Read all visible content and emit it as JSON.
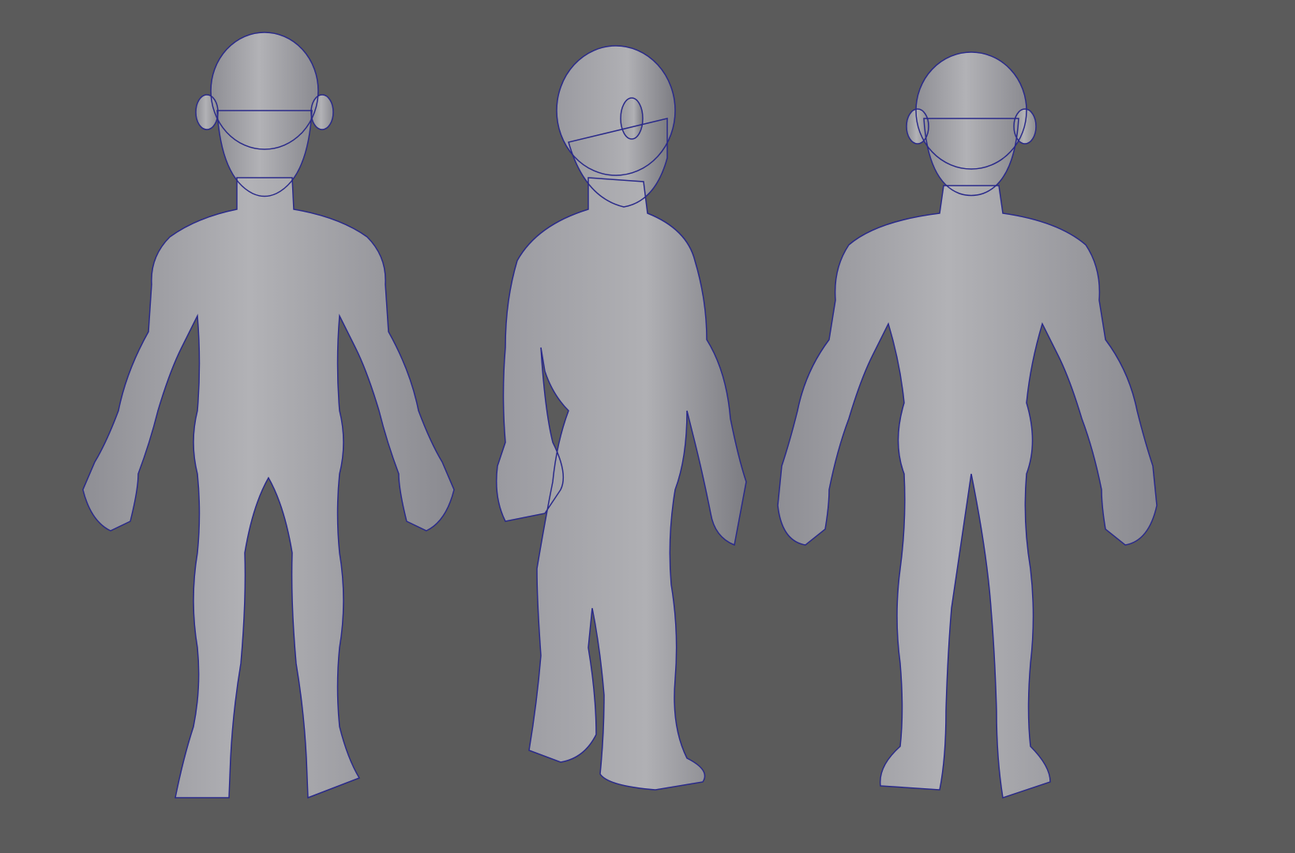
{
  "scene": {
    "background_color": "#5b5b5b",
    "mesh_color": "#a9a9ad",
    "mesh_shadow_color": "#7e7e84",
    "wire_color": "#2a2a8a",
    "views": [
      "front",
      "three-quarter-back",
      "back"
    ]
  }
}
